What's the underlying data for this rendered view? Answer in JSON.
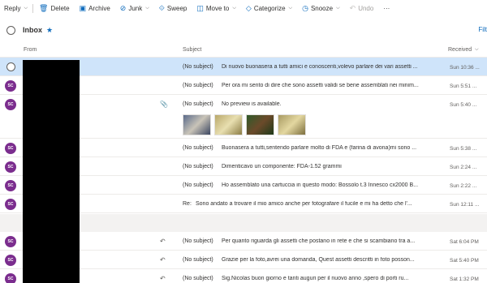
{
  "toolbar": {
    "reply": "Reply",
    "delete": "Delete",
    "archive": "Archive",
    "junk": "Junk",
    "sweep": "Sweep",
    "move_to": "Move to",
    "categorize": "Categorize",
    "snooze": "Snooze",
    "undo": "Undo",
    "more": "···"
  },
  "folder": {
    "title": "Inbox",
    "filter": "Filt"
  },
  "columns": {
    "from": "From",
    "subject": "Subject",
    "received": "Received"
  },
  "messages": [
    {
      "subject": "(No subject)",
      "preview": "Di nuovo buonasera a tutti amici e conoscenti,volevo parlare dei vari assetti ...",
      "received": "Sun 10:36 ...",
      "selected": true
    },
    {
      "avatar": "SC",
      "subject": "(No subject)",
      "preview": "Per ora mi sento di dire che sono assetti validi se bene assemblati nei minim...",
      "received": "Sun 5:51 ..."
    },
    {
      "avatar": "SC",
      "subject": "(No subject)",
      "preview": "No preview is available.",
      "received": "Sun 5:40 ...",
      "has_attachment": true
    },
    {
      "avatar": "SC",
      "subject": "(No subject)",
      "preview": "Buonasera a tutti,sentendo parlare molto di FDA e (farina di avona)mi sono ...",
      "received": "Sun 5:38 ..."
    },
    {
      "avatar": "SC",
      "subject": "(No subject)",
      "preview": "Dimenticavo un componente: FDA-1.52 grammi",
      "received": "Sun 2:24 ..."
    },
    {
      "avatar": "SC",
      "subject": "(No subject)",
      "preview": "Ho assemblato una cartuccia in questo modo: Bossolo t.3 Innesco cx2000 B...",
      "received": "Sun 2:22 ..."
    },
    {
      "avatar": "SC",
      "subject": "Re:",
      "preview": "Sono andato a trovare il mio amico anche per fotografare il fucile e mi ha detto che l'...",
      "received": "Sun 12:11 ..."
    },
    {
      "avatar": "SC",
      "subject": "(No subject)",
      "preview": "Per quanto riguarda gli assetti che postano in rete e che si scambiano tra a...",
      "received": "Sat 6:04 PM",
      "replied": true
    },
    {
      "avatar": "SC",
      "subject": "(No subject)",
      "preview": "Grazie per la foto,avrei una domanda, Quest assetti descritti in foto posson...",
      "received": "Sat 5:40 PM",
      "replied": true
    },
    {
      "avatar": "SC",
      "subject": "(No subject)",
      "preview": "Sig.Nicolas buon giorno e tanti auguri per il nuovo anno ,spero di porti ru...",
      "received": "Sat 1:32 PM",
      "replied": true
    }
  ],
  "colors": {
    "accent": "#0f6cbd",
    "avatar": "#7b2d8e",
    "selected": "#cfe4fa"
  }
}
